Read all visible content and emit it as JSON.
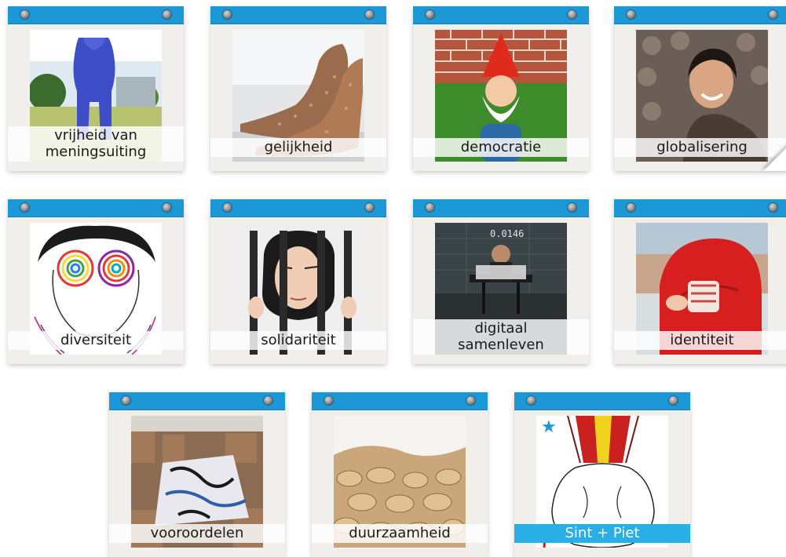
{
  "topics": [
    {
      "label": "vrijheid van\nmeningsuiting"
    },
    {
      "label": "gelijkheid"
    },
    {
      "label": "democratie"
    },
    {
      "label": "globalisering"
    },
    {
      "label": "diversiteit"
    },
    {
      "label": "solidariteit"
    },
    {
      "label": "digitaal\nsamenleven"
    },
    {
      "label": "identiteit"
    },
    {
      "label": "vooroordelen"
    },
    {
      "label": "duurzaamheid"
    },
    {
      "label": "Sint + Piet"
    }
  ],
  "digital_counter": "0.0146",
  "colors": {
    "header_bar": "#1c98d6",
    "card_bg": "#f1efeb",
    "highlight_label": "#2aaee6",
    "star": "#1c98d6"
  },
  "icons": {
    "pin": "pin-icon",
    "star": "star-icon"
  }
}
